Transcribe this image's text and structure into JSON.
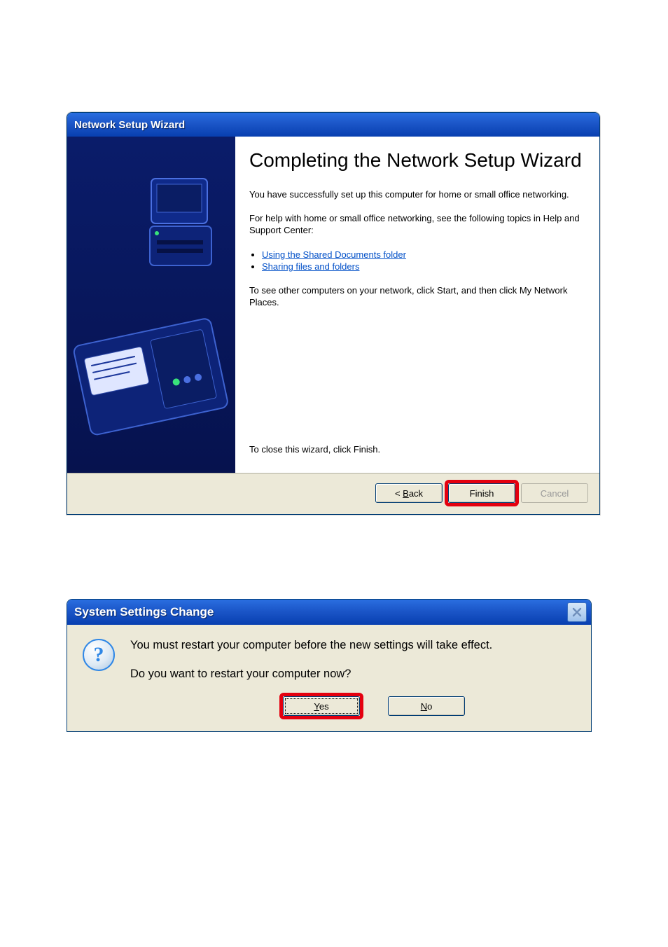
{
  "wizard": {
    "title": "Network Setup Wizard",
    "heading": "Completing the Network Setup Wizard",
    "p1": "You have successfully set up this computer for home or small office networking.",
    "p2": "For help with home or small office networking, see the following topics in Help and Support Center:",
    "links": [
      "Using the Shared Documents folder",
      "Sharing files and folders"
    ],
    "p3": "To see other computers on your network, click Start, and then click My Network Places.",
    "p4": "To close this wizard, click Finish.",
    "buttons": {
      "back": "< Back",
      "finish": "Finish",
      "cancel": "Cancel"
    }
  },
  "dialog": {
    "title": "System Settings Change",
    "line1": "You must restart your computer before the new settings will take effect.",
    "line2": "Do you want to restart your computer now?",
    "yes": "Yes",
    "no": "No"
  }
}
